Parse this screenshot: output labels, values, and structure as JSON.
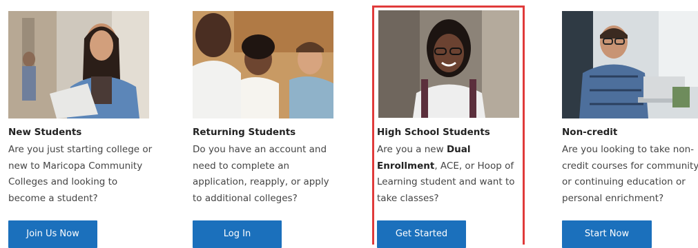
{
  "cards": [
    {
      "title": "New Students",
      "description": "Are you just starting college or new to Maricopa Community Colleges and looking to become a student?",
      "button": "Join Us Now",
      "photo": "student-with-papers-photo"
    },
    {
      "title": "Returning Students",
      "description": "Do you have an account and need to complete an application, reapply, or apply to additional colleges?",
      "button": "Log In",
      "photo": "students-talking-photo"
    },
    {
      "title": "High School Students",
      "description_parts": [
        "Are you a new ",
        "Dual Enrollment",
        ", ACE, or Hoop of Learning student and want to take classes?"
      ],
      "button": "Get Started",
      "photo": "high-school-student-photo"
    },
    {
      "title": "Non-credit",
      "description": "Are you looking to take non-credit courses for community or continuing education or personal enrichment?",
      "button": "Start Now",
      "photo": "adult-learner-laptop-photo"
    }
  ],
  "colors": {
    "button_bg": "#1b70bc",
    "button_text": "#ffffff",
    "highlight_border": "#e03a3a"
  }
}
